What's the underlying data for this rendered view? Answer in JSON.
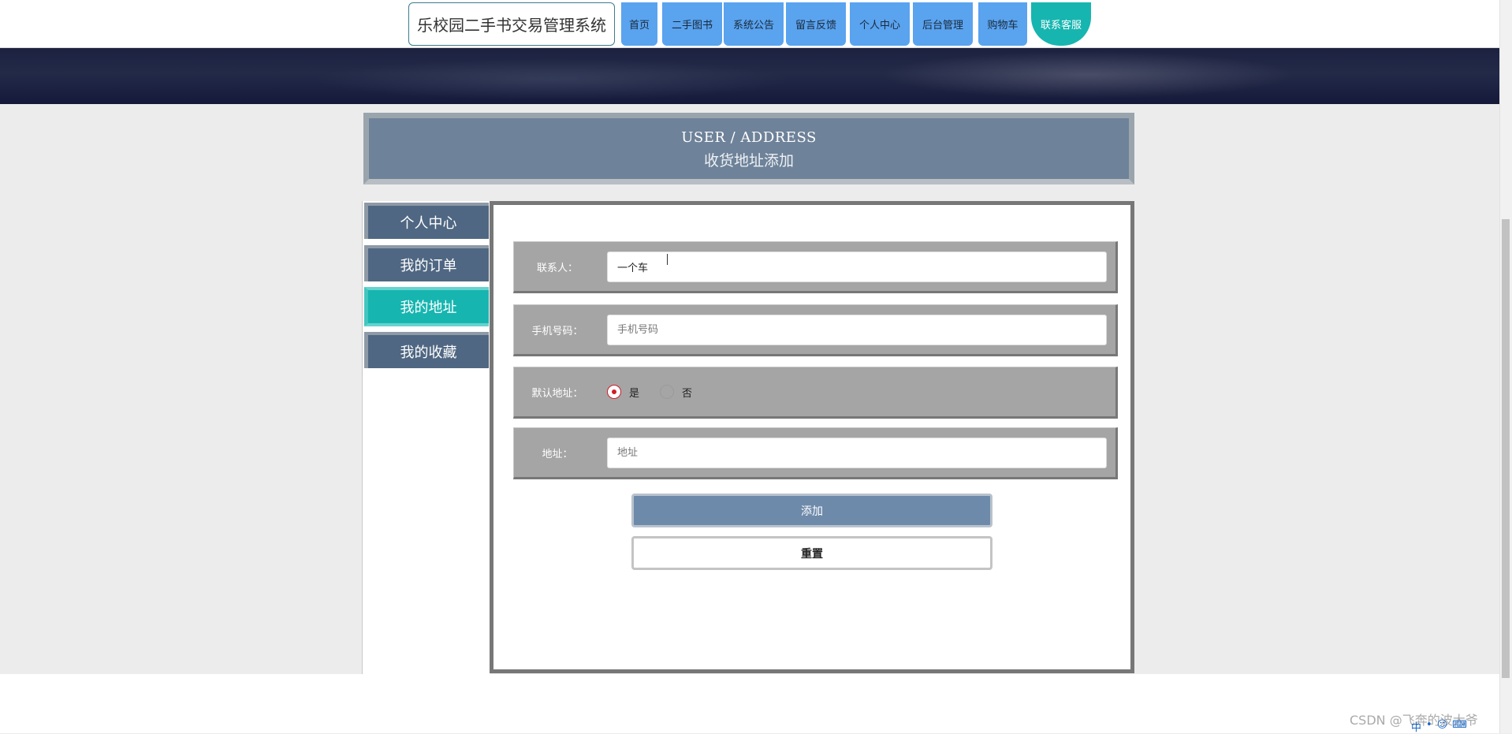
{
  "nav": {
    "brand": "乐校园二手书交易管理系统",
    "items": [
      {
        "label": "首页"
      },
      {
        "label": "二手图书"
      },
      {
        "label": "系统公告"
      },
      {
        "label": "留言反馈"
      },
      {
        "label": "个人中心"
      },
      {
        "label": "后台管理"
      },
      {
        "label": "购物车"
      },
      {
        "label": "联系客服"
      }
    ],
    "accent_color": "#5aa3ef",
    "contact_color": "#17b5b0"
  },
  "header": {
    "title_en": "USER / ADDRESS",
    "title_cn": "收货地址添加"
  },
  "sidebar": {
    "items": [
      {
        "label": "个人中心"
      },
      {
        "label": "我的订单"
      },
      {
        "label": "我的地址"
      },
      {
        "label": "我的收藏"
      }
    ],
    "active_index": 2
  },
  "form": {
    "contact": {
      "label": "联系人：",
      "value": "一个车",
      "placeholder": ""
    },
    "phone": {
      "label": "手机号码：",
      "value": "",
      "placeholder": "手机号码"
    },
    "default_address": {
      "label": "默认地址：",
      "options": [
        {
          "label": "是",
          "checked": true
        },
        {
          "label": "否",
          "checked": false
        }
      ]
    },
    "address": {
      "label": "地址：",
      "value": "",
      "placeholder": "地址"
    },
    "submit_label": "添加",
    "reset_label": "重置"
  },
  "watermark": "CSDN @飞奔的波大爷",
  "tray": {
    "ime": "中"
  }
}
